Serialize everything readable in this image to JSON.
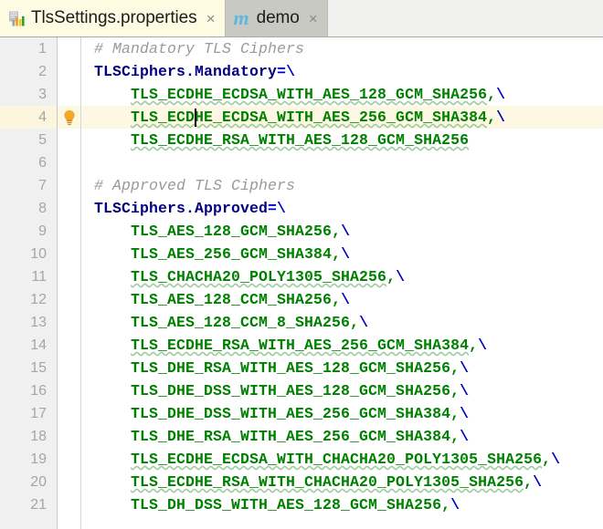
{
  "tabs": [
    {
      "label": "TlsSettings.properties",
      "icon": "properties-file-icon",
      "close": "×",
      "active": true
    },
    {
      "label": "demo",
      "icon": "maven-m-icon",
      "close": "×",
      "active": false
    }
  ],
  "editor": {
    "gutter": {
      "line_numbers": [
        "1",
        "2",
        "3",
        "4",
        "5",
        "6",
        "7",
        "8",
        "9",
        "10",
        "11",
        "12",
        "13",
        "14",
        "15",
        "16",
        "17",
        "18",
        "19",
        "20",
        "21"
      ]
    },
    "markers": {
      "intention_bulb": {
        "icon": "lightbulb-icon",
        "line": 4
      }
    },
    "caret": {
      "line": 4,
      "column": 12
    },
    "highlighted_line": 4,
    "colors": {
      "comment": "#9a9a9a",
      "key": "#000080",
      "operator": "#0000c8",
      "value": "#008000",
      "squiggle": "#9fcc9f",
      "current_line_bg": "#fdf8e3",
      "gutter_bg": "#f0f0f0",
      "active_tab_bg": "#fdfbe2",
      "inactive_tab_bg": "#c9c9c4"
    },
    "lines": [
      {
        "n": 1,
        "type": "comment",
        "text": "# Mandatory TLS Ciphers"
      },
      {
        "n": 2,
        "type": "assign",
        "key": "TLSCiphers.Mandatory",
        "op": "=",
        "cont": "\\"
      },
      {
        "n": 3,
        "type": "value",
        "indent": "    ",
        "value": "TLS_ECDHE_ECDSA_WITH_AES_128_GCM_SHA256",
        "comma": ",",
        "cont": "\\",
        "squiggle": true
      },
      {
        "n": 4,
        "type": "value",
        "indent": "    ",
        "value": "TLS_ECDHE_ECDSA_WITH_AES_256_GCM_SHA384",
        "comma": ",",
        "cont": "\\",
        "squiggle": true
      },
      {
        "n": 5,
        "type": "value",
        "indent": "    ",
        "value": "TLS_ECDHE_RSA_WITH_AES_128_GCM_SHA256",
        "comma": "",
        "cont": "",
        "squiggle": true
      },
      {
        "n": 6,
        "type": "blank",
        "text": ""
      },
      {
        "n": 7,
        "type": "comment",
        "text": "# Approved TLS Ciphers"
      },
      {
        "n": 8,
        "type": "assign",
        "key": "TLSCiphers.Approved",
        "op": "=",
        "cont": "\\"
      },
      {
        "n": 9,
        "type": "value",
        "indent": "    ",
        "value": "TLS_AES_128_GCM_SHA256",
        "comma": ",",
        "cont": "\\",
        "squiggle": false
      },
      {
        "n": 10,
        "type": "value",
        "indent": "    ",
        "value": "TLS_AES_256_GCM_SHA384",
        "comma": ",",
        "cont": "\\",
        "squiggle": false
      },
      {
        "n": 11,
        "type": "value",
        "indent": "    ",
        "value": "TLS_CHACHA20_POLY1305_SHA256",
        "comma": ",",
        "cont": "\\",
        "squiggle": true
      },
      {
        "n": 12,
        "type": "value",
        "indent": "    ",
        "value": "TLS_AES_128_CCM_SHA256",
        "comma": ",",
        "cont": "\\",
        "squiggle": false
      },
      {
        "n": 13,
        "type": "value",
        "indent": "    ",
        "value": "TLS_AES_128_CCM_8_SHA256",
        "comma": ",",
        "cont": "\\",
        "squiggle": false
      },
      {
        "n": 14,
        "type": "value",
        "indent": "    ",
        "value": "TLS_ECDHE_RSA_WITH_AES_256_GCM_SHA384",
        "comma": ",",
        "cont": "\\",
        "squiggle": true
      },
      {
        "n": 15,
        "type": "value",
        "indent": "    ",
        "value": "TLS_DHE_RSA_WITH_AES_128_GCM_SHA256",
        "comma": ",",
        "cont": "\\",
        "squiggle": false
      },
      {
        "n": 16,
        "type": "value",
        "indent": "    ",
        "value": "TLS_DHE_DSS_WITH_AES_128_GCM_SHA256",
        "comma": ",",
        "cont": "\\",
        "squiggle": false
      },
      {
        "n": 17,
        "type": "value",
        "indent": "    ",
        "value": "TLS_DHE_DSS_WITH_AES_256_GCM_SHA384",
        "comma": ",",
        "cont": "\\",
        "squiggle": false
      },
      {
        "n": 18,
        "type": "value",
        "indent": "    ",
        "value": "TLS_DHE_RSA_WITH_AES_256_GCM_SHA384",
        "comma": ",",
        "cont": "\\",
        "squiggle": false
      },
      {
        "n": 19,
        "type": "value",
        "indent": "    ",
        "value": "TLS_ECDHE_ECDSA_WITH_CHACHA20_POLY1305_SHA256",
        "comma": ",",
        "cont": "\\",
        "squiggle": true
      },
      {
        "n": 20,
        "type": "value",
        "indent": "    ",
        "value": "TLS_ECDHE_RSA_WITH_CHACHA20_POLY1305_SHA256",
        "comma": ",",
        "cont": "\\",
        "squiggle": true
      },
      {
        "n": 21,
        "type": "value",
        "indent": "    ",
        "value": "TLS_DH_DSS_WITH_AES_128_GCM_SHA256",
        "comma": ",",
        "cont": "\\",
        "squiggle": false
      }
    ]
  }
}
